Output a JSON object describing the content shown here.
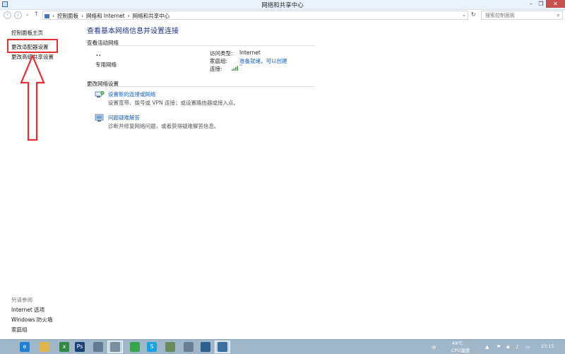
{
  "window": {
    "title": "网络和共享中心",
    "minimize": "–",
    "restore": "❐",
    "close": "✕"
  },
  "nav": {
    "back": "‹",
    "forward": "›",
    "recent": "⌄",
    "up": "↑",
    "breadcrumbs": [
      "控制面板",
      "网络和 Internet",
      "网络和共享中心"
    ],
    "separator": "›",
    "address_dropdown": "⌄",
    "refresh": "↻",
    "search_placeholder": "搜索控制面板",
    "search_icon": "⌕"
  },
  "left_pane": {
    "links": [
      "控制面板主页",
      "更改适配器设置",
      "更改高级共享设置"
    ],
    "see_also_title": "另请参阅",
    "see_also": [
      "Internet 选项",
      "Windows 防火墙",
      "家庭组"
    ]
  },
  "main": {
    "heading": "查看基本网络信息并设置连接",
    "active_section": "查看活动网络",
    "network_dots": "..",
    "network_type": "专用网络",
    "access_label": "访问类型:",
    "access_value": "Internet",
    "homegroup_label": "家庭组:",
    "homegroup_value": "准备就绪，可以创建",
    "connection_label": "连接:",
    "connection_value": "''",
    "change_section": "更改网络设置",
    "tasks": [
      {
        "title": "设置新的连接或网络",
        "desc": "设置宽带、拨号或 VPN 连接；或设置路由器或接入点。"
      },
      {
        "title": "问题疑难解答",
        "desc": "诊断并修复网络问题，或者获得疑难解答信息。"
      }
    ]
  },
  "taskbar": {
    "temp": "49℃",
    "cpu_label": "CPU温度",
    "time": "23:15",
    "ime": "中",
    "apps": [
      "ie",
      "explorer",
      "excel",
      "ps",
      "media",
      "player",
      "phone",
      "skype",
      "browser",
      "folder",
      "calc",
      "control-panel"
    ]
  },
  "colors": {
    "link": "#1a5fb4",
    "heading": "#1e3287",
    "highlight": "#e03134",
    "taskbar": "#9fb7c8"
  }
}
